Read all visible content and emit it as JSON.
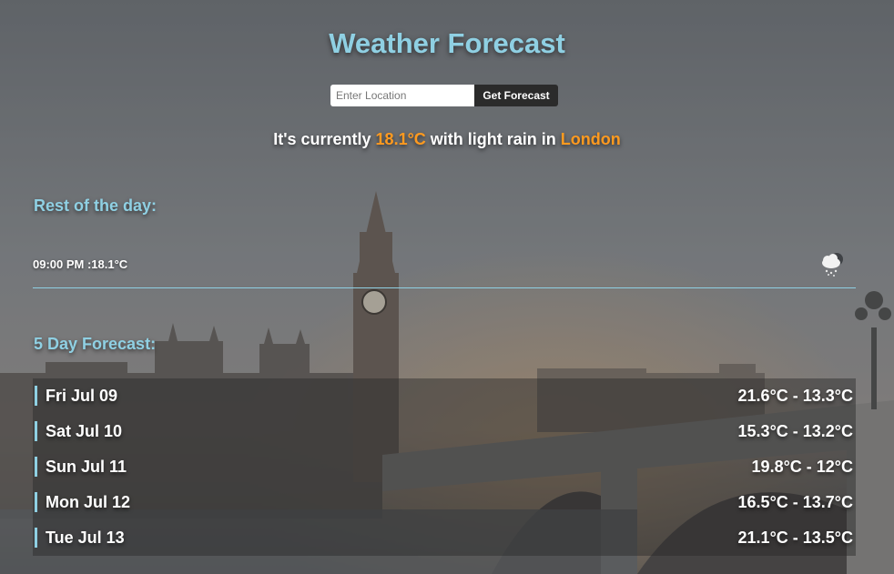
{
  "header": {
    "title": "Weather Forecast"
  },
  "search": {
    "placeholder": "Enter Location",
    "value": "",
    "button_label": "Get Forecast"
  },
  "current": {
    "prefix": "It's currently ",
    "temperature": "18.1°C",
    "middle": " with light rain in ",
    "location": "London"
  },
  "rest_of_day": {
    "heading": "Rest of the day:",
    "items": [
      {
        "text": "09:00 PM :18.1°C",
        "icon": "rain-cloud-icon"
      }
    ]
  },
  "five_day": {
    "heading": "5 Day Forecast:",
    "days": [
      {
        "day": "Fri Jul 09",
        "range": "21.6°C - 13.3°C"
      },
      {
        "day": "Sat Jul 10",
        "range": "15.3°C - 13.2°C"
      },
      {
        "day": "Sun Jul 11",
        "range": "19.8°C - 12°C"
      },
      {
        "day": "Mon Jul 12",
        "range": "16.5°C - 13.7°C"
      },
      {
        "day": "Tue Jul 13",
        "range": "21.1°C - 13.5°C"
      }
    ]
  },
  "colors": {
    "accent": "#8fd0e3",
    "highlight": "#ff9a1f",
    "button_bg": "#2b2b2b"
  }
}
